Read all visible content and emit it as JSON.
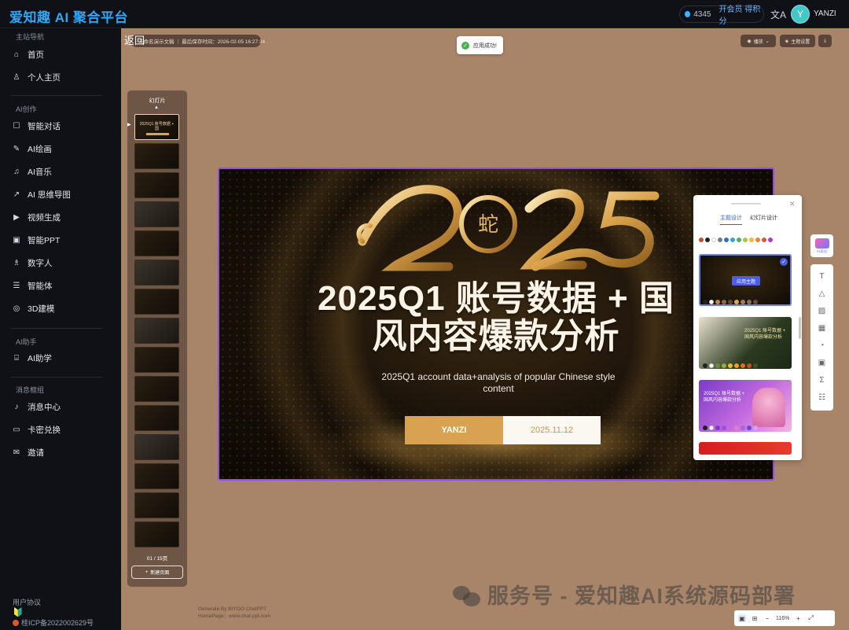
{
  "app": {
    "brand": "爱知趣 AI 聚合平台"
  },
  "header": {
    "credits": "4345",
    "vip_label": "开会员 得积分",
    "translate_icon": "translate-icon",
    "avatar_char": "Y",
    "username": "YANZI"
  },
  "sidebar": {
    "sections": [
      {
        "title": "主站导航",
        "items": [
          {
            "label": "首页",
            "icon": "home-icon"
          },
          {
            "label": "个人主页",
            "icon": "user-icon"
          }
        ]
      },
      {
        "title": "AI创作",
        "items": [
          {
            "label": "智能对话",
            "icon": "chat-icon"
          },
          {
            "label": "AI绘画",
            "icon": "brush-icon"
          },
          {
            "label": "AI音乐",
            "icon": "music-icon"
          },
          {
            "label": "AI 思维导图",
            "icon": "mindmap-icon"
          },
          {
            "label": "视频生成",
            "icon": "play-icon"
          },
          {
            "label": "智能PPT",
            "icon": "ppt-icon"
          },
          {
            "label": "数字人",
            "icon": "person-icon"
          },
          {
            "label": "智能体",
            "icon": "agent-icon"
          },
          {
            "label": "3D建模",
            "icon": "cube-icon"
          }
        ]
      },
      {
        "title": "AI助手",
        "items": [
          {
            "label": "AI助学",
            "icon": "study-icon"
          }
        ]
      },
      {
        "title": "消息框组",
        "items": [
          {
            "label": "消息中心",
            "icon": "bell-icon"
          },
          {
            "label": "卡密兑换",
            "icon": "card-icon"
          },
          {
            "label": "邀请",
            "icon": "mail-icon"
          }
        ]
      }
    ],
    "footer": {
      "agreement": "用户协议",
      "icp": "桂ICP备2022002629号"
    }
  },
  "editor": {
    "back": "返回",
    "doc_title": "未命名演示文稿",
    "last_saved": "最后保存时间：2026-02-05 16:27:34",
    "toast": "应用成功!",
    "toolbar": {
      "play": "播放",
      "theme": "主题设置",
      "download_icon": "download-icon"
    },
    "thumbs": {
      "title": "幻灯片",
      "page": "01 / 15页",
      "new_page": "新建页面",
      "count": 15
    },
    "generated_by": "Generate By BIYOO ChatPPT",
    "homepage": "HomePage：www.chat-ppt.com",
    "zoom": "116%"
  },
  "slide": {
    "year": "2025",
    "snake_char": "蛇",
    "title_line1": "2025Q1 账号数据 + 国",
    "title_line2": "风内容爆款分析",
    "subtitle_line1": "2025Q1 account data+analysis of popular Chinese style",
    "subtitle_line2": "content",
    "author": "YANZI",
    "date": "2025.11.12"
  },
  "theme_panel": {
    "tab_theme": "主题设计",
    "tab_slide": "幻灯片设计",
    "apply": "应用主题",
    "card2_text": "2025Q1 账号数据 + 国风内容爆款分析",
    "card3_text": "2025Q1 账号数据 + 国风内容爆款分析",
    "ai_label": "AI美化"
  },
  "watermark": "服务号 - 爱知趣AI系统源码部署",
  "colors": {
    "accent": "#2fa8f5",
    "slide_gold": "#d9a152",
    "selection": "#8e4fe0",
    "canvas": "#a88469"
  }
}
